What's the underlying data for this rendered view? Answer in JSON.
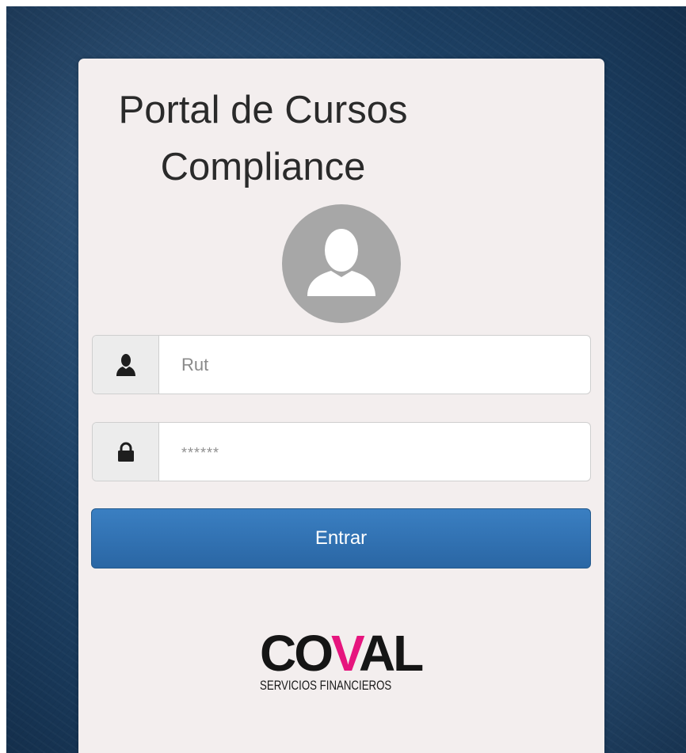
{
  "login": {
    "title_line1": "Portal de Cursos",
    "title_line2": "Compliance",
    "rut_placeholder": "Rut",
    "password_placeholder": "******",
    "submit_label": "Entrar"
  },
  "icons": {
    "avatar": "user-silhouette-icon",
    "rut_addon": "user-icon",
    "password_addon": "lock-icon"
  },
  "brand": {
    "logo_prefix": "CO",
    "logo_accent": "V",
    "logo_suffix": "AL",
    "tagline": "SERVICIOS FINANCIEROS",
    "accent_color": "#e6157e"
  },
  "colors": {
    "background": "#1f4469",
    "card": "#f3eeee",
    "button": "#2f6fb0"
  }
}
